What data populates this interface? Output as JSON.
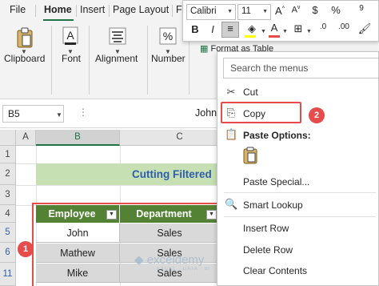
{
  "ribbon": {
    "tabs": [
      "File",
      "Home",
      "Insert",
      "Page Layout",
      "F"
    ],
    "active_tab": "Home",
    "groups": {
      "clipboard": "Clipboard",
      "font": "Font",
      "alignment": "Alignment",
      "number": "Number"
    },
    "format_as_table": "Format as Table"
  },
  "mini_toolbar": {
    "font_name": "Calibri",
    "font_size": "11",
    "currency_symbol": "$",
    "percent_symbol": "%",
    "bold": "B",
    "italic": "I",
    "font_color_letter": "A",
    "grow_font": "A^",
    "shrink_font": "A"
  },
  "formula_bar": {
    "name_box": "B5",
    "content": "John"
  },
  "grid": {
    "columns": [
      "A",
      "B",
      "C"
    ],
    "rows": [
      "1",
      "2",
      "3",
      "4",
      "5",
      "6",
      "11"
    ],
    "title": "Cutting Filtered",
    "headers": [
      "Employee",
      "Department"
    ],
    "data": [
      [
        "John",
        "Sales"
      ],
      [
        "Mathew",
        "Sales"
      ],
      [
        "Mike",
        "Sales"
      ]
    ]
  },
  "badges": {
    "selection": "1",
    "copy": "2"
  },
  "context_menu": {
    "search_placeholder": "Search the menus",
    "items": {
      "cut": "Cut",
      "copy": "Copy",
      "paste_options": "Paste Options:",
      "paste_special": "Paste Special...",
      "smart_lookup": "Smart Lookup",
      "insert_row": "Insert Row",
      "delete_row": "Delete Row",
      "clear_contents": "Clear Contents"
    }
  },
  "watermark": {
    "name": "exceldemy",
    "tagline": "EXCEL · DATA · BI"
  },
  "colors": {
    "accent_green": "#217346",
    "header_green": "#548235",
    "title_fill": "#c6e0b4",
    "highlight_red": "#e74c4c"
  }
}
